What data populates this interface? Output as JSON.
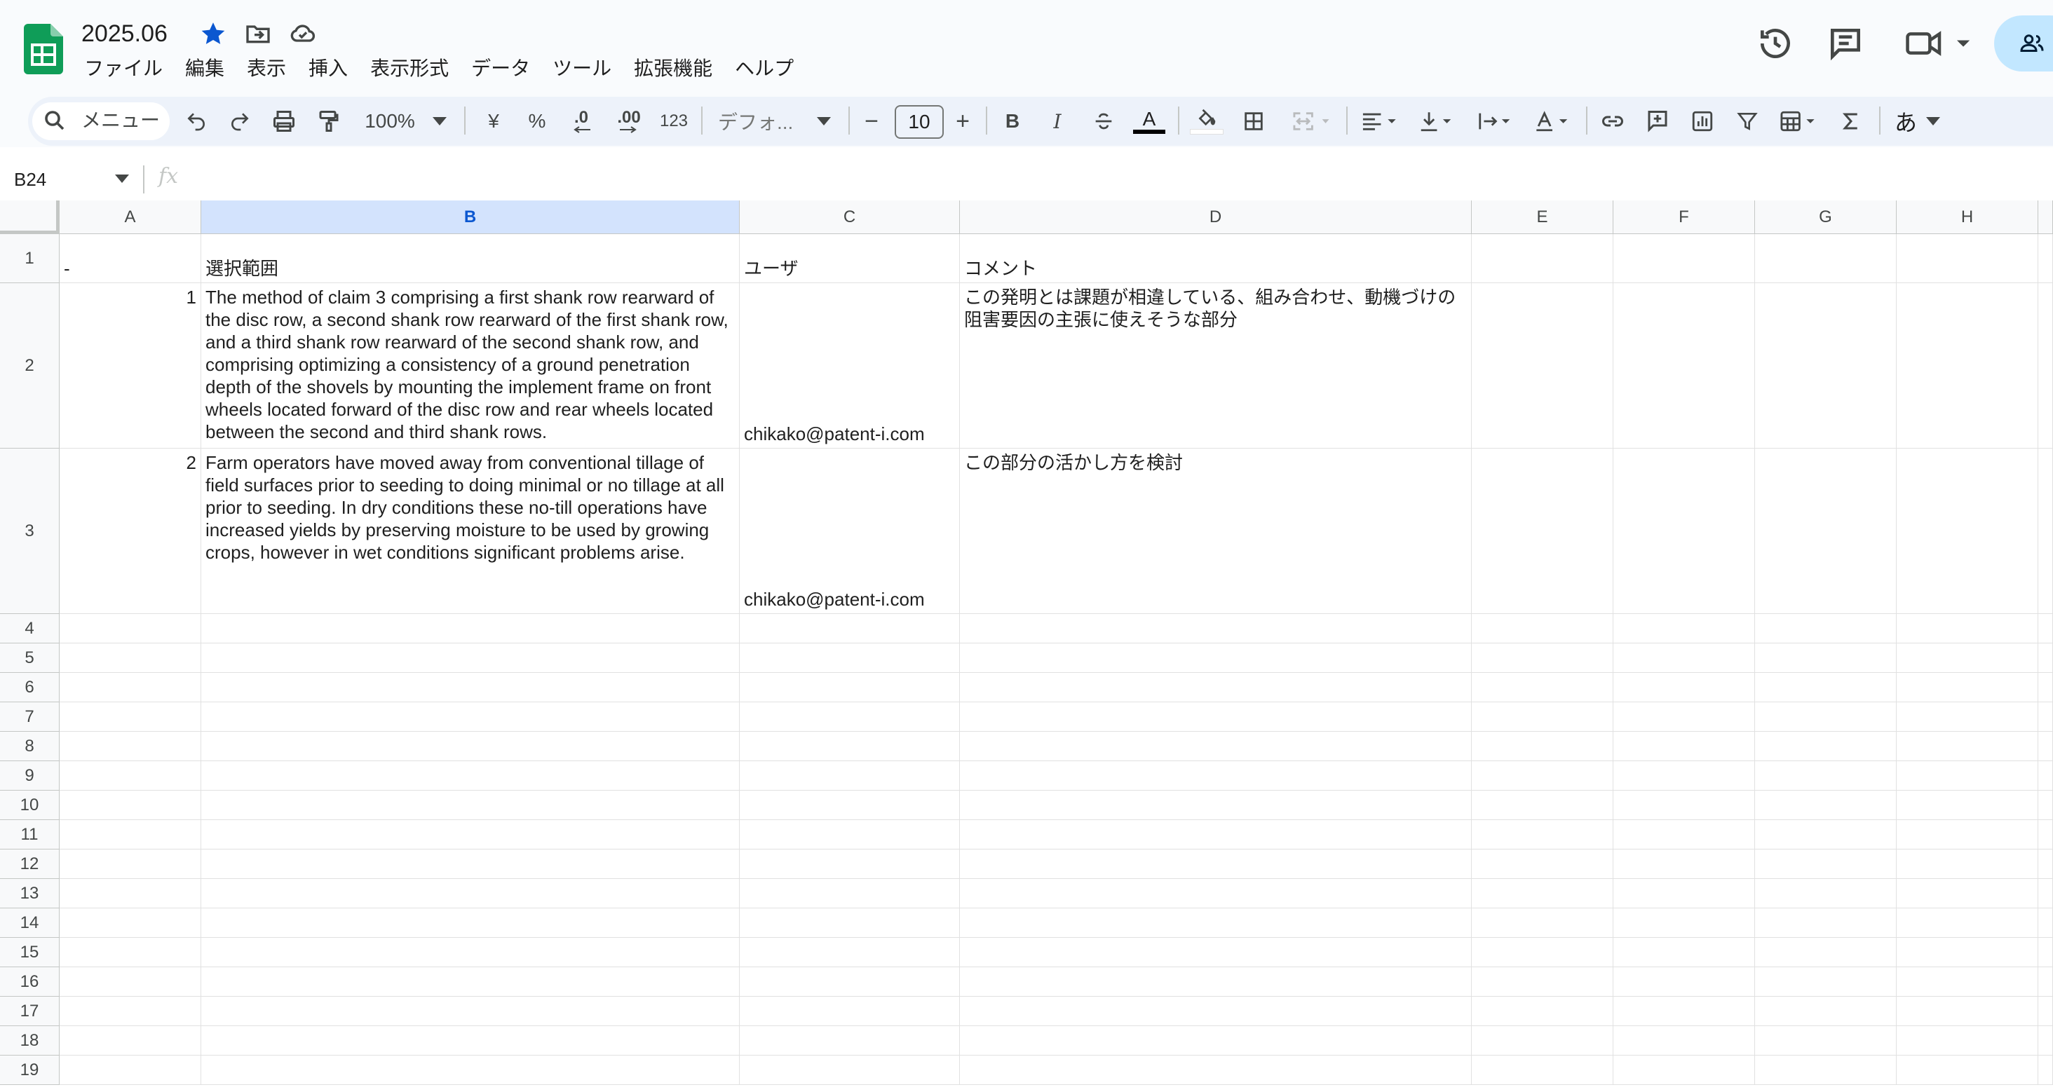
{
  "doc": {
    "title": "2025.06"
  },
  "menu": [
    "ファイル",
    "編集",
    "表示",
    "挿入",
    "表示形式",
    "データ",
    "ツール",
    "拡張機能",
    "ヘルプ"
  ],
  "toolbar": {
    "search_label": "メニュー",
    "zoom": "100%",
    "currency": "¥",
    "percent": "%",
    "dec_decrease": ".0",
    "dec_increase": ".00",
    "number_format": "123",
    "font": "デフォ...",
    "font_size": "10",
    "minus": "−",
    "plus": "+",
    "bold": "B",
    "italic": "I",
    "text_color_glyph": "A",
    "ime": "あ"
  },
  "formula_bar": {
    "name_box": "B24",
    "fx": "fx"
  },
  "columns": [
    "A",
    "B",
    "C",
    "D",
    "E",
    "F",
    "G",
    "H"
  ],
  "selected_column": "B",
  "rows": [
    "1",
    "2",
    "3",
    "4",
    "5",
    "6",
    "7",
    "8",
    "9",
    "10",
    "11",
    "12",
    "13",
    "14",
    "15",
    "16",
    "17",
    "18",
    "19"
  ],
  "cells": {
    "A1": "-",
    "B1": "選択範囲",
    "C1": "ユーザ",
    "D1": "コメント",
    "A2": "1",
    "B2": "The method of claim 3 comprising a first shank row rearward of the disc row, a second shank row rearward of the first shank row, and a third shank row rearward of the second shank row, and comprising optimizing a consistency of a ground penetration depth of the shovels by mounting the implement frame on front wheels located forward of the disc row and rear wheels located between the second and third shank rows.",
    "C2": "chikako@patent-i.com",
    "D2": "この発明とは課題が相違している、組み合わせ、動機づけの阻害要因の主張に使えそうな部分",
    "A3": "2",
    "B3": "Farm operators have moved away from conventional tillage of field surfaces prior to seeding to doing minimal or no tillage at all prior to seeding. In dry conditions these no-till operations have increased yields by preserving moisture to be used by growing crops, however in wet conditions significant problems arise.",
    "C3": "chikako@patent-i.com",
    "D3": "この部分の活かし方を検討"
  },
  "colors": {
    "accent": "#0b57d0",
    "sheets_green": "#0f9d58",
    "share_bg": "#c2e7ff",
    "selected_header": "#d3e3fd"
  }
}
